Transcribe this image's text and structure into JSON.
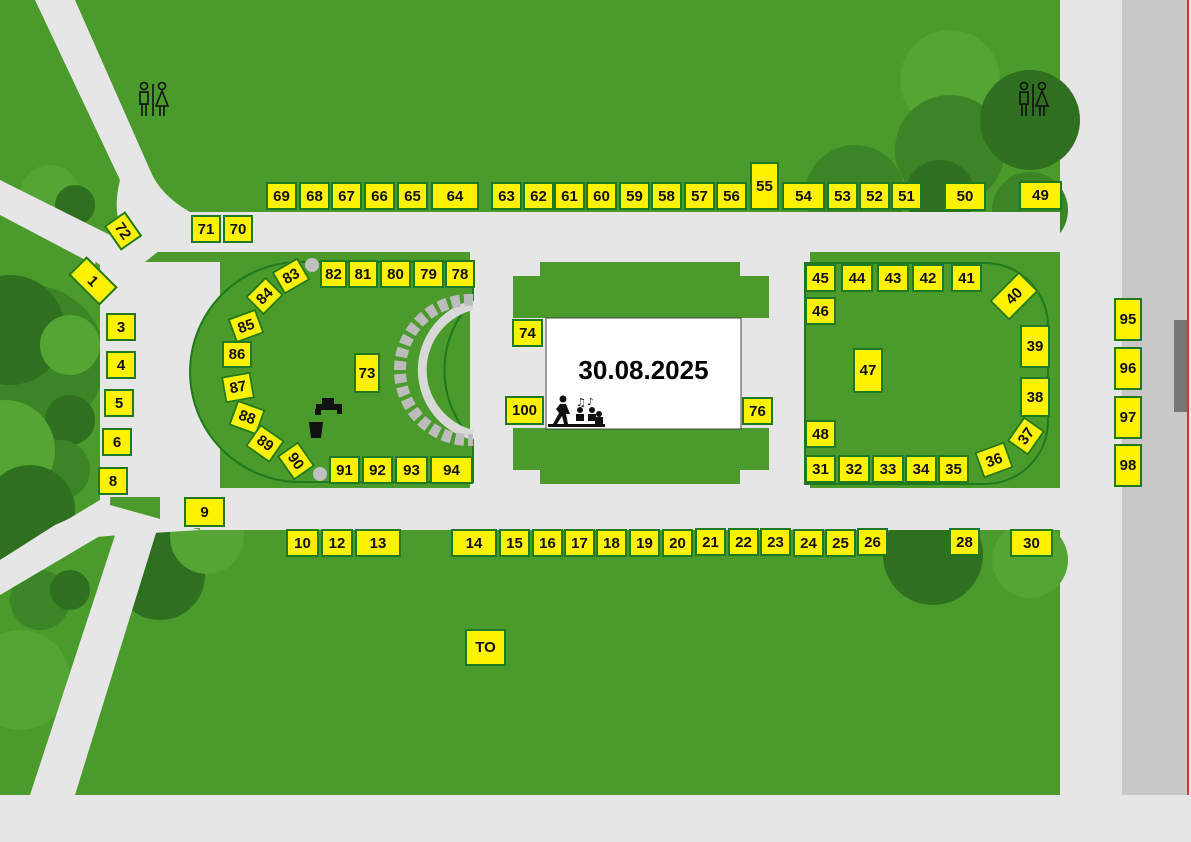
{
  "event_date": "30.08.2025",
  "colors": {
    "grass": "#4a9a2c",
    "path": "#e6e6e6",
    "stall_fill": "#fff200",
    "stall_border": "#1f7a1f",
    "road": "#c8c8c8",
    "road_edge": "#e03030"
  },
  "icons": {
    "toilet": "toilet-icon",
    "water_tap": "water-tap-icon",
    "stage_performers": "performers-icon"
  },
  "stalls": {
    "s1": "1",
    "s3": "3",
    "s4": "4",
    "s5": "5",
    "s6": "6",
    "s8": "8",
    "s9": "9",
    "s10": "10",
    "s12": "12",
    "s13": "13",
    "s14": "14",
    "s15": "15",
    "s16": "16",
    "s17": "17",
    "s18": "18",
    "s19": "19",
    "s20": "20",
    "s21": "21",
    "s22": "22",
    "s23": "23",
    "s24": "24",
    "s25": "25",
    "s26": "26",
    "s28": "28",
    "s30": "30",
    "s31": "31",
    "s32": "32",
    "s33": "33",
    "s34": "34",
    "s35": "35",
    "s36": "36",
    "s37": "37",
    "s38": "38",
    "s39": "39",
    "s40": "40",
    "s41": "41",
    "s42": "42",
    "s43": "43",
    "s44": "44",
    "s45": "45",
    "s46": "46",
    "s47": "47",
    "s48": "48",
    "s49": "49",
    "s50": "50",
    "s51": "51",
    "s52": "52",
    "s53": "53",
    "s54": "54",
    "s55": "55",
    "s56": "56",
    "s57": "57",
    "s58": "58",
    "s59": "59",
    "s60": "60",
    "s61": "61",
    "s62": "62",
    "s63": "63",
    "s64": "64",
    "s65": "65",
    "s66": "66",
    "s67": "67",
    "s68": "68",
    "s69": "69",
    "s70": "70",
    "s71": "71",
    "s72": "72",
    "s73": "73",
    "s74": "74",
    "s76": "76",
    "s78": "78",
    "s79": "79",
    "s80": "80",
    "s81": "81",
    "s82": "82",
    "s83": "83",
    "s84": "84",
    "s85": "85",
    "s86": "86",
    "s87": "87",
    "s88": "88",
    "s89": "89",
    "s90": "90",
    "s91": "91",
    "s92": "92",
    "s93": "93",
    "s94": "94",
    "s95": "95",
    "s96": "96",
    "s97": "97",
    "s98": "98",
    "s100": "100",
    "sTO": "TO"
  }
}
